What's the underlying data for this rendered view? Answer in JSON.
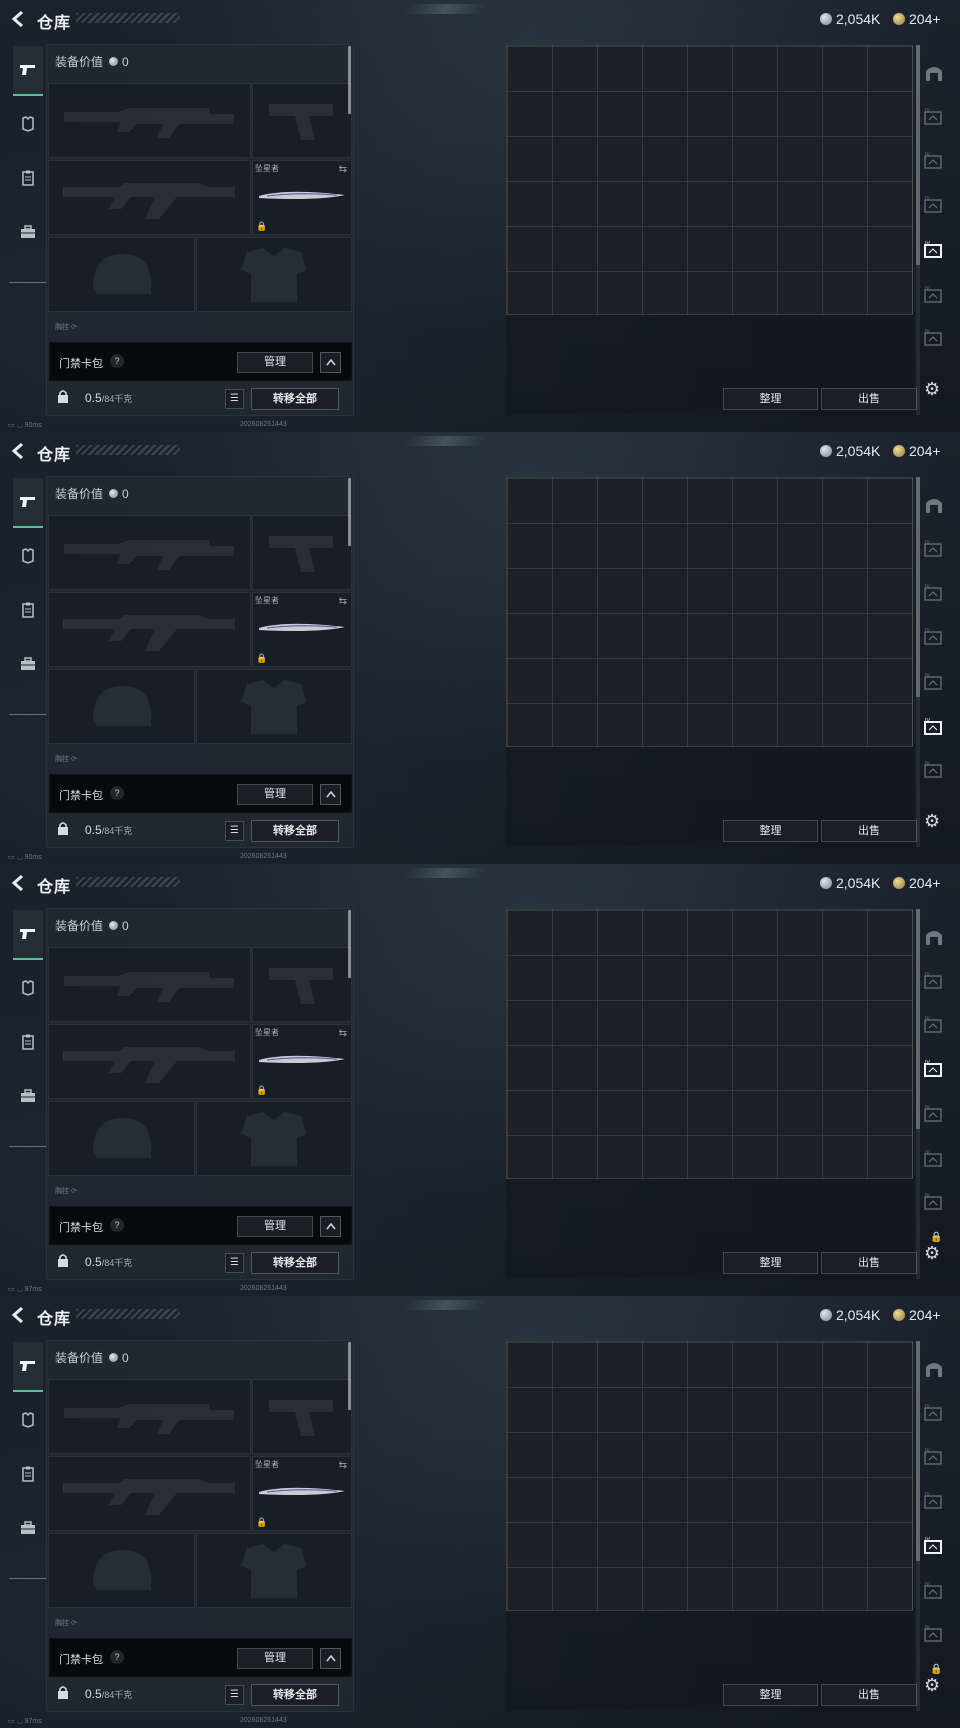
{
  "frames": [
    {
      "ping": "90ms",
      "active_right_icon": 4,
      "show_lock": false
    },
    {
      "ping": "90ms",
      "active_right_icon": 5,
      "show_lock": false
    },
    {
      "ping": "97ms",
      "active_right_icon": 3,
      "show_lock": true
    },
    {
      "ping": "97ms",
      "active_right_icon": 4,
      "show_lock": true
    }
  ],
  "header": {
    "title": "仓库",
    "silver_amount": "2,054K",
    "gold_amount": "204+"
  },
  "sidebar": {
    "tabs": [
      {
        "name": "pistol-icon"
      },
      {
        "name": "armor-icon"
      },
      {
        "name": "clipboard-icon"
      },
      {
        "name": "toolbox-icon"
      }
    ]
  },
  "equipment": {
    "value_label": "装备价值",
    "value": "0",
    "knife_label": "坠星者",
    "bottom_hint": "胸挂   ⟳"
  },
  "access_card": {
    "label": "门禁卡包",
    "help": "?",
    "manage": "管理",
    "expand": "^"
  },
  "weight": {
    "current": "0.5",
    "max": "/84千克",
    "transfer_all": "转移全部"
  },
  "storage": {
    "sort": "整理",
    "sell": "出售"
  },
  "status": {
    "build": "202608261443"
  },
  "colors": {
    "accent_green": "#4ec98f",
    "panel": "#202932"
  }
}
